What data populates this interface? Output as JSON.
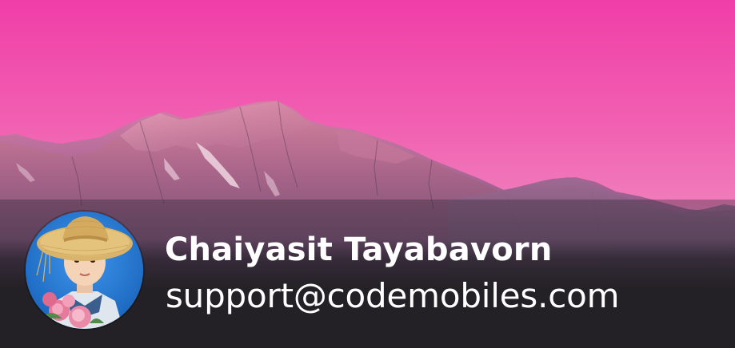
{
  "profile": {
    "name": "Chaiyasit Tayabavorn",
    "email": "support@codemobiles.com"
  },
  "cover": {
    "sky_top": "#f03ea8",
    "sky_bottom": "#ee9ac4",
    "mountain_light": "#c46c9c",
    "mountain_dark": "#463a55"
  },
  "avatar": {
    "background": "#1e79d8",
    "hat": "#d9b46a",
    "flowers": "#e77a9b"
  }
}
